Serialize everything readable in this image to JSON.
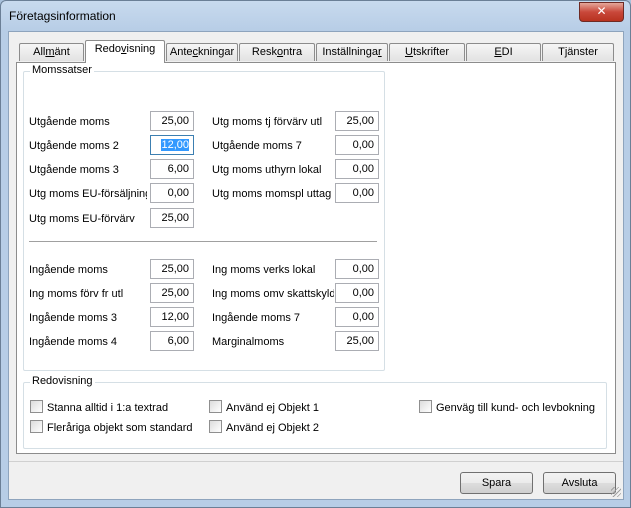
{
  "window": {
    "title": "Företagsinformation",
    "close_glyph": "✕"
  },
  "tabs": [
    {
      "label_pre": "All",
      "label_ul": "m",
      "label_post": "änt"
    },
    {
      "label_pre": "Redo",
      "label_ul": "v",
      "label_post": "isning"
    },
    {
      "label_pre": "Ante",
      "label_ul": "c",
      "label_post": "kningar"
    },
    {
      "label_pre": "Resk",
      "label_ul": "o",
      "label_post": "ntra"
    },
    {
      "label_pre": "Inställninga",
      "label_ul": "r",
      "label_post": ""
    },
    {
      "label_pre": "",
      "label_ul": "U",
      "label_post": "tskrifter"
    },
    {
      "label_pre": "",
      "label_ul": "E",
      "label_post": "DI"
    },
    {
      "label_pre": "Tjänster",
      "label_ul": "",
      "label_post": ""
    }
  ],
  "momssatser": {
    "title": "Momssatser",
    "utgaende_left": [
      {
        "label": "Utgående moms",
        "value": "25,00"
      },
      {
        "label": "Utgående moms 2",
        "value": "12,00"
      },
      {
        "label": "Utgående moms 3",
        "value": "6,00"
      },
      {
        "label": "Utg moms EU-försäljning",
        "value": "0,00"
      },
      {
        "label": "Utg moms EU-förvärv",
        "value": "25,00"
      }
    ],
    "utgaende_right": [
      {
        "label": "Utg moms tj förvärv utl",
        "value": "25,00"
      },
      {
        "label": "Utgående moms 7",
        "value": "0,00"
      },
      {
        "label": "Utg moms uthyrn lokal",
        "value": "0,00"
      },
      {
        "label": "Utg moms momspl uttag",
        "value": "0,00"
      }
    ],
    "ingaende_left": [
      {
        "label": "Ingående moms",
        "value": "25,00"
      },
      {
        "label": "Ing moms förv fr utl",
        "value": "25,00"
      },
      {
        "label": "Ingående moms 3",
        "value": "12,00"
      },
      {
        "label": "Ingående moms 4",
        "value": "6,00"
      }
    ],
    "ingaende_right": [
      {
        "label": "Ing moms verks lokal",
        "value": "0,00"
      },
      {
        "label": "Ing moms omv skattskyldighet",
        "value": "0,00"
      },
      {
        "label": "Ingående moms 7",
        "value": "0,00"
      },
      {
        "label": "Marginalmoms",
        "value": "25,00"
      }
    ]
  },
  "redovisning": {
    "title": "Redovisning",
    "checkboxes": [
      {
        "label": "Stanna alltid i 1:a textrad",
        "checked": false
      },
      {
        "label": "Fleråriga objekt som standard",
        "checked": false
      },
      {
        "label": "Använd ej Objekt 1",
        "checked": false
      },
      {
        "label": "Använd ej Objekt 2",
        "checked": false
      },
      {
        "label": "Genväg till kund- och levbokning",
        "checked": false
      }
    ]
  },
  "buttons": {
    "save": "Spara",
    "exit": "Avsluta"
  }
}
